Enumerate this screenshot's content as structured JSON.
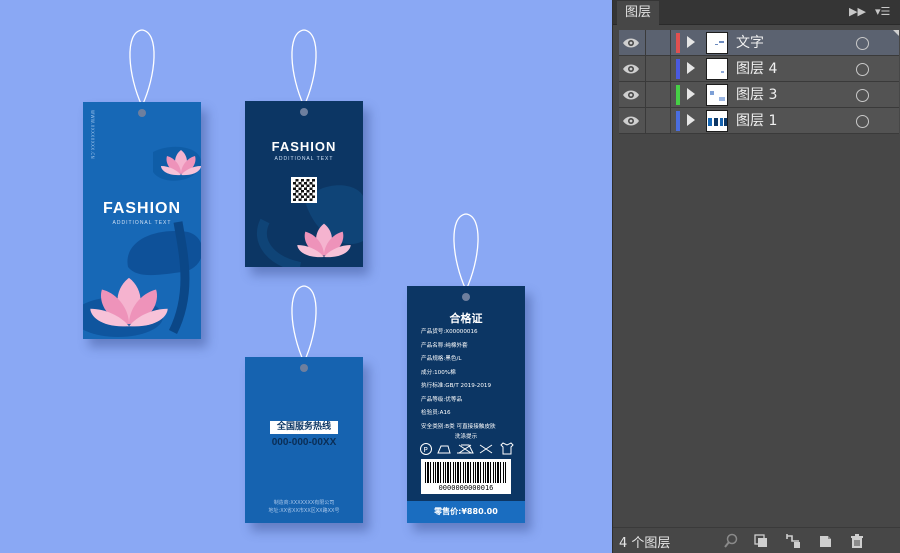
{
  "tag1": {
    "title": "FASHION",
    "subtitle": "ADDITIONAL TEXT",
    "vertical_text": "WWW.XXXXXXXX.CN"
  },
  "tag2": {
    "title": "FASHION",
    "subtitle": "ADDITIONAL TEXT"
  },
  "tag3": {
    "hotline_label": "全国服务热线",
    "phone": "000-000-00XX",
    "company": "制造商:XXXXXXX有限公司",
    "address": "地址:XX省XX市XX区XX路XX号"
  },
  "tag4": {
    "title": "合格证",
    "lines": [
      "产品货号:X00000016",
      "产品名称:纯棉外套",
      "产品规格:黑色/L",
      "成分:100%棉",
      "执行标准:GB/T 2019-2019",
      "产品等级:优等品",
      "检验员:A16",
      "安全类别:B类 可直接接触皮肤"
    ],
    "wash_title": "洗涤提示",
    "barcode_number": "0000000000016",
    "price": "零售价:¥880.00"
  },
  "panel": {
    "tab_label": "图层",
    "layers": [
      {
        "name": "文字",
        "color": "#e05050",
        "selected": true
      },
      {
        "name": "图层 4",
        "color": "#4a5ae0",
        "selected": false
      },
      {
        "name": "图层 3",
        "color": "#46d046",
        "selected": false
      },
      {
        "name": "图层 1",
        "color": "#4a6ee0",
        "selected": false
      }
    ],
    "layer_count": "4 个图层"
  },
  "colors": {
    "canvas_bg": "#8aa8f4",
    "tag_blue": "#1768b6",
    "tag_navy": "#0c3664",
    "lotus_pink": "#f2a2c4"
  },
  "icons": [
    "eye-icon",
    "expand-arrow-icon",
    "target-circle-icon",
    "search-icon",
    "clipping-mask-icon",
    "new-sublayer-icon",
    "new-layer-icon",
    "trash-icon",
    "collapse-panel-icon",
    "panel-menu-icon"
  ]
}
